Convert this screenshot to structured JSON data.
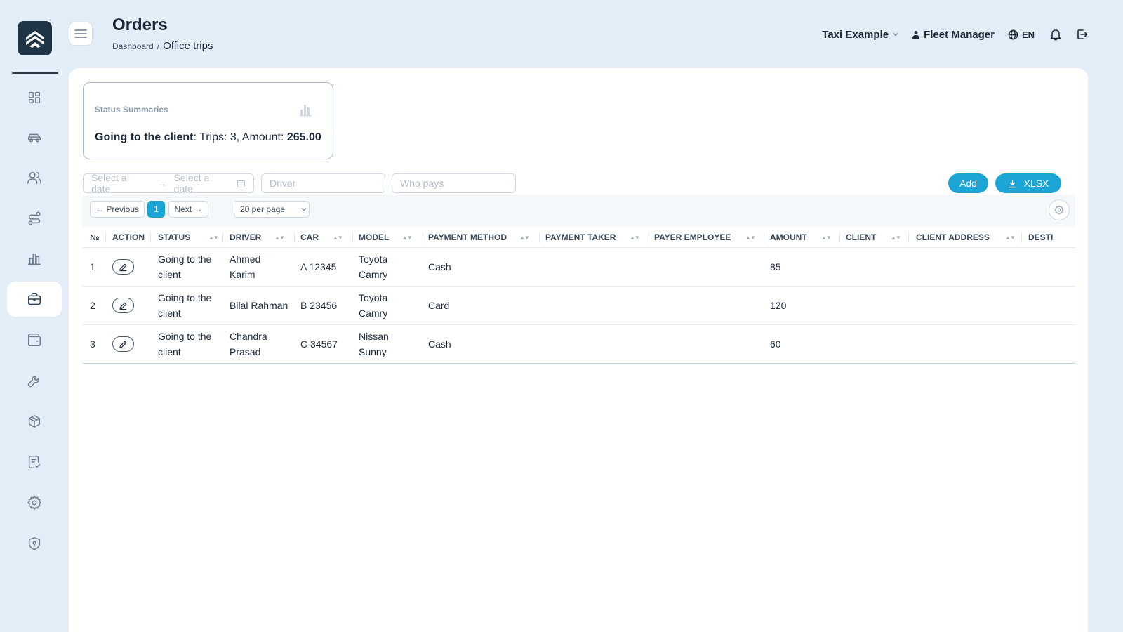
{
  "header": {
    "title": "Orders",
    "breadcrumb": {
      "parent": "Dashboard",
      "separator": "/",
      "current": "Office trips"
    },
    "company": "Taxi Example",
    "user": "Fleet Manager",
    "language": "EN"
  },
  "sidebar": {
    "items": [
      {
        "name": "dashboard-icon",
        "active": false
      },
      {
        "name": "car-icon",
        "active": false
      },
      {
        "name": "users-icon",
        "active": false
      },
      {
        "name": "route-icon",
        "active": false
      },
      {
        "name": "bar-chart-icon",
        "active": false
      },
      {
        "name": "briefcase-icon",
        "active": true
      },
      {
        "name": "wallet-icon",
        "active": false
      },
      {
        "name": "wrench-icon",
        "active": false
      },
      {
        "name": "package-icon",
        "active": false
      },
      {
        "name": "checklist-icon",
        "active": false
      },
      {
        "name": "settings-icon",
        "active": false
      },
      {
        "name": "shield-icon",
        "active": false
      }
    ]
  },
  "summary": {
    "title": "Status Summaries",
    "status": "Going to the client",
    "trips_label": ": Trips: 3, Amount: ",
    "amount": "265.00"
  },
  "filters": {
    "date_start_placeholder": "Select a date",
    "date_end_placeholder": "Select a date",
    "driver_placeholder": "Driver",
    "payer_placeholder": "Who pays",
    "add_label": "Add",
    "export_label": "XLSX"
  },
  "pagination": {
    "previous": "← Previous",
    "current_page": "1",
    "next": "Next →",
    "per_page": "20 per page"
  },
  "table": {
    "columns": [
      "№",
      "ACTION",
      "STATUS",
      "DRIVER",
      "CAR",
      "MODEL",
      "PAYMENT METHOD",
      "PAYMENT TAKER",
      "PAYER EMPLOYEE",
      "AMOUNT",
      "CLIENT",
      "CLIENT ADDRESS",
      "DESTI"
    ],
    "rows": [
      {
        "no": "1",
        "status_1": "Going to the",
        "status_2": "client",
        "driver_1": "Ahmed",
        "driver_2": "Karim",
        "car": "A 12345",
        "model_1": "Toyota",
        "model_2": "Camry",
        "payment_method": "Cash",
        "payment_taker": "",
        "payer_employee": "",
        "amount": "85",
        "client": "",
        "client_address": ""
      },
      {
        "no": "2",
        "status_1": "Going to the",
        "status_2": "client",
        "driver_1": "Bilal Rahman",
        "driver_2": "",
        "car": "B 23456",
        "model_1": "Toyota",
        "model_2": "Camry",
        "payment_method": "Card",
        "payment_taker": "",
        "payer_employee": "",
        "amount": "120",
        "client": "",
        "client_address": ""
      },
      {
        "no": "3",
        "status_1": "Going to the",
        "status_2": "client",
        "driver_1": "Chandra",
        "driver_2": "Prasad",
        "car": "C 34567",
        "model_1": "Nissan",
        "model_2": "Sunny",
        "payment_method": "Cash",
        "payment_taker": "",
        "payer_employee": "",
        "amount": "60",
        "client": "",
        "client_address": ""
      }
    ]
  },
  "colors": {
    "accent": "#1aa5d4",
    "background": "#e3edf7",
    "logo": "#1f3447"
  }
}
